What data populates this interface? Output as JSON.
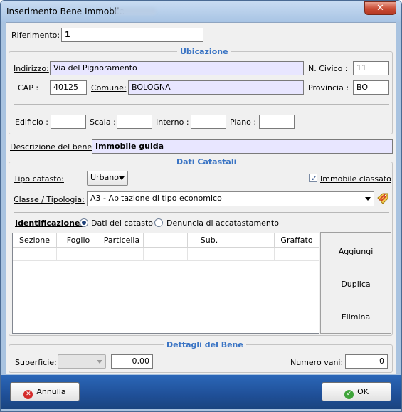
{
  "window": {
    "title": "Inserimento Bene Immobile",
    "close_glyph": "✕"
  },
  "riferimento": {
    "label": "Riferimento:",
    "value": "1"
  },
  "ubicazione": {
    "title": "Ubicazione",
    "indirizzo_label": "Indirizzo:",
    "indirizzo_value": "Via del Pignoramento",
    "ncivico_label": "N. Civico :",
    "ncivico_value": "11",
    "cap_label": "CAP :",
    "cap_value": "40125",
    "comune_label": "Comune:",
    "comune_value": "BOLOGNA",
    "provincia_label": "Provincia :",
    "provincia_value": "BO",
    "edificio_label": "Edificio :",
    "edificio_value": "",
    "scala_label": "Scala :",
    "scala_value": "",
    "interno_label": "Interno :",
    "interno_value": "",
    "piano_label": "Piano :",
    "piano_value": ""
  },
  "descrizione": {
    "label": "Descrizione del bene:",
    "value": "Immobile guida"
  },
  "dati_catastali": {
    "title": "Dati Catastali",
    "tipo_label": "Tipo catasto:",
    "tipo_value": "Urbano",
    "classato_label": "Immobile classato",
    "classato_checked": true,
    "classe_label": "Classe / Tipologia:",
    "classe_value": "A3 - Abitazione di tipo economico",
    "identificazione_label": "Identificazione:",
    "radio_options": [
      "Dati del catasto",
      "Denuncia di accatastamento"
    ],
    "radio_selected": 0,
    "columns": [
      "Sezione",
      "Foglio",
      "Particella",
      "",
      "Sub.",
      "",
      "Graffato"
    ],
    "buttons": {
      "aggiungi": "Aggiungi",
      "duplica": "Duplica",
      "elimina": "Elimina"
    }
  },
  "dettagli": {
    "title": "Dettagli del Bene",
    "superficie_label": "Superficie:",
    "superficie_select": "",
    "superficie_value": "0,00",
    "vani_label": "Numero vani:",
    "vani_value": "0"
  },
  "footer": {
    "annulla_label": "Annulla",
    "annulla_icon": "✕",
    "ok_label": "OK",
    "ok_icon": "✓"
  }
}
